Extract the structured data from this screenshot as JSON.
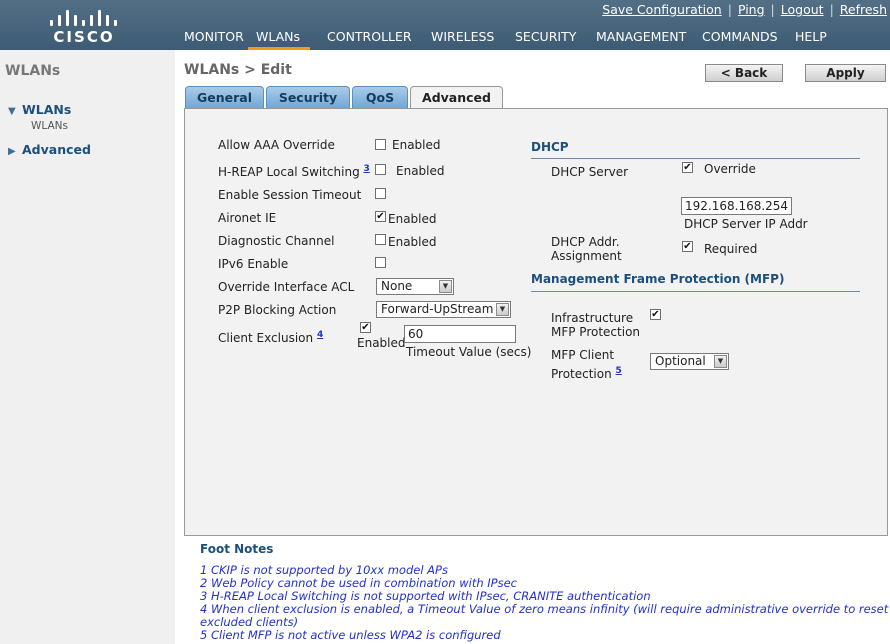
{
  "brand": {
    "logo_text": "CISCO"
  },
  "utility_links": [
    "Save Configuration",
    "Ping",
    "Logout",
    "Refresh"
  ],
  "nav": [
    "MONITOR",
    "WLANs",
    "CONTROLLER",
    "WIRELESS",
    "SECURITY",
    "MANAGEMENT",
    "COMMANDS",
    "HELP"
  ],
  "nav_active": "WLANs",
  "sidebar": {
    "title": "WLANs",
    "sections": [
      {
        "label": "WLANs",
        "expanded": true,
        "children": [
          "WLANs"
        ]
      },
      {
        "label": "Advanced",
        "expanded": false
      }
    ]
  },
  "page_title": "WLANs > Edit",
  "buttons": {
    "back": "< Back",
    "apply": "Apply"
  },
  "tabs": [
    "General",
    "Security",
    "QoS",
    "Advanced"
  ],
  "active_tab": "Advanced",
  "left_settings": {
    "allow_aaa_override": {
      "label": "Allow AAA Override",
      "checked": false,
      "suffix": "Enabled"
    },
    "hreap_local_switching": {
      "label": "H-REAP Local Switching",
      "footnote": "3",
      "checked": false,
      "suffix": "Enabled"
    },
    "enable_session_timeout": {
      "label": "Enable Session Timeout",
      "checked": false
    },
    "aironet_ie": {
      "label": "Aironet IE",
      "checked": true,
      "suffix": "Enabled"
    },
    "diagnostic_channel": {
      "label": "Diagnostic Channel",
      "checked": false,
      "suffix": "Enabled"
    },
    "ipv6_enable": {
      "label": "IPv6 Enable",
      "checked": false
    },
    "override_interface_acl": {
      "label": "Override Interface ACL",
      "value": "None"
    },
    "p2p_blocking_action": {
      "label": "P2P Blocking Action",
      "value": "Forward-UpStream"
    },
    "client_exclusion": {
      "label": "Client Exclusion",
      "footnote": "4",
      "checked": true,
      "suffix": "Enabled",
      "timeout_value": "60",
      "timeout_caption": "Timeout Value (secs)"
    }
  },
  "dhcp": {
    "title": "DHCP",
    "server_label": "DHCP Server",
    "override_checked": true,
    "override_label": "Override",
    "server_ip": "192.168.168.254",
    "server_ip_caption": "DHCP Server IP Addr",
    "assignment_label_line1": "DHCP Addr.",
    "assignment_label_line2": "Assignment",
    "required_checked": true,
    "required_label": "Required"
  },
  "mfp": {
    "title": "Management Frame Protection (MFP)",
    "infra_label_line1": "Infrastructure",
    "infra_label_line2": "MFP Protection",
    "infra_checked": true,
    "client_label_line1": "MFP Client",
    "client_label_line2": "Protection",
    "client_footnote": "5",
    "client_value": "Optional"
  },
  "footnotes": {
    "title": "Foot Notes",
    "items": [
      "1 CKIP is not supported by 10xx model APs",
      "2 Web Policy cannot be used in combination with IPsec",
      "3 H-REAP Local Switching is not supported with IPsec, CRANITE authentication",
      "4 When client exclusion is enabled, a Timeout Value of zero means infinity (will require administrative override to reset",
      "excluded clients)",
      "5 Client MFP is not active unless WPA2 is configured"
    ]
  },
  "colors": {
    "header": "#46637b",
    "nav_active_underline": "#f29a14",
    "tab_blue": "#7fb2dc",
    "section_heading": "#1c4f7c",
    "footnote_text": "#2231c4"
  }
}
